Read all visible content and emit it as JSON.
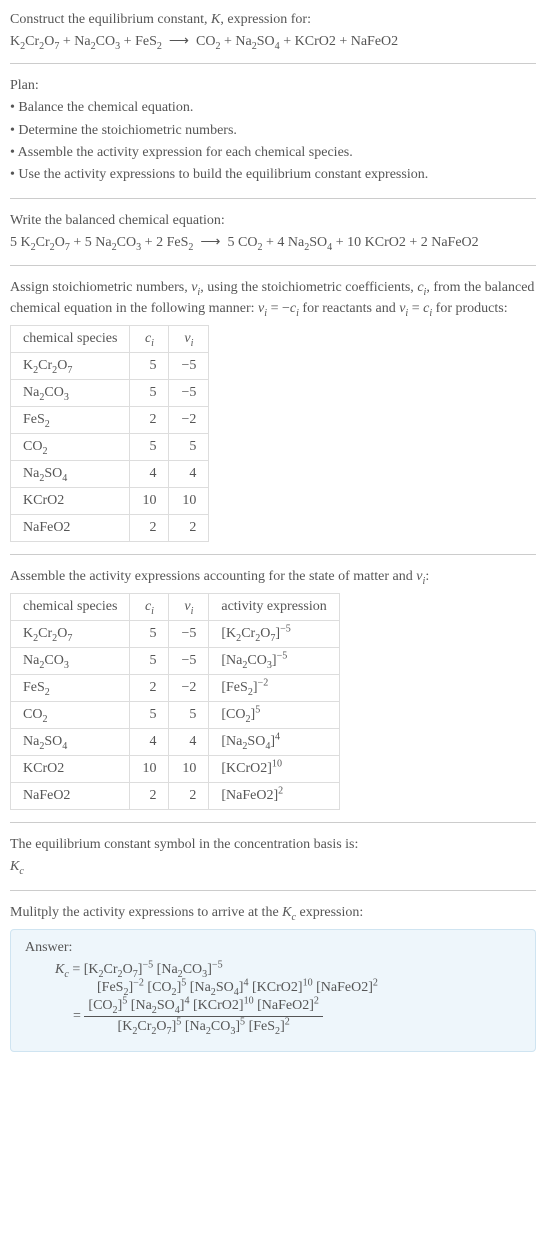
{
  "intro": {
    "line1_html": "Construct the equilibrium constant, <i>K</i>, expression for:",
    "equation_html": "K<sub>2</sub>Cr<sub>2</sub>O<sub>7</sub> + Na<sub>2</sub>CO<sub>3</sub> + FeS<sub>2</sub> &nbsp;⟶&nbsp; CO<sub>2</sub> + Na<sub>2</sub>SO<sub>4</sub> + KCrO2 + NaFeO2"
  },
  "plan": {
    "title": "Plan:",
    "items": [
      "• Balance the chemical equation.",
      "• Determine the stoichiometric numbers.",
      "• Assemble the activity expression for each chemical species.",
      "• Use the activity expressions to build the equilibrium constant expression."
    ]
  },
  "balanced": {
    "title": "Write the balanced chemical equation:",
    "equation_html": "5 K<sub>2</sub>Cr<sub>2</sub>O<sub>7</sub> + 5 Na<sub>2</sub>CO<sub>3</sub> + 2 FeS<sub>2</sub> &nbsp;⟶&nbsp; 5 CO<sub>2</sub> + 4 Na<sub>2</sub>SO<sub>4</sub> + 10 KCrO2 + 2 NaFeO2"
  },
  "assign": {
    "text_html": "Assign stoichiometric numbers, <i>ν<sub>i</sub></i>, using the stoichiometric coefficients, <i>c<sub>i</sub></i>, from the balanced chemical equation in the following manner: <i>ν<sub>i</sub></i> = −<i>c<sub>i</sub></i> for reactants and <i>ν<sub>i</sub></i> = <i>c<sub>i</sub></i> for products:"
  },
  "table1": {
    "headers": {
      "species": "chemical species",
      "ci_html": "<i>c<sub>i</sub></i>",
      "vi_html": "<i>ν<sub>i</sub></i>"
    },
    "rows": [
      {
        "species_html": "K<sub>2</sub>Cr<sub>2</sub>O<sub>7</sub>",
        "ci": "5",
        "vi": "−5"
      },
      {
        "species_html": "Na<sub>2</sub>CO<sub>3</sub>",
        "ci": "5",
        "vi": "−5"
      },
      {
        "species_html": "FeS<sub>2</sub>",
        "ci": "2",
        "vi": "−2"
      },
      {
        "species_html": "CO<sub>2</sub>",
        "ci": "5",
        "vi": "5"
      },
      {
        "species_html": "Na<sub>2</sub>SO<sub>4</sub>",
        "ci": "4",
        "vi": "4"
      },
      {
        "species_html": "KCrO2",
        "ci": "10",
        "vi": "10"
      },
      {
        "species_html": "NaFeO2",
        "ci": "2",
        "vi": "2"
      }
    ]
  },
  "assemble": {
    "text_html": "Assemble the activity expressions accounting for the state of matter and <i>ν<sub>i</sub></i>:"
  },
  "table2": {
    "headers": {
      "species": "chemical species",
      "ci_html": "<i>c<sub>i</sub></i>",
      "vi_html": "<i>ν<sub>i</sub></i>",
      "activity": "activity expression"
    },
    "rows": [
      {
        "species_html": "K<sub>2</sub>Cr<sub>2</sub>O<sub>7</sub>",
        "ci": "5",
        "vi": "−5",
        "activity_html": "[K<sub>2</sub>Cr<sub>2</sub>O<sub>7</sub>]<sup>−5</sup>"
      },
      {
        "species_html": "Na<sub>2</sub>CO<sub>3</sub>",
        "ci": "5",
        "vi": "−5",
        "activity_html": "[Na<sub>2</sub>CO<sub>3</sub>]<sup>−5</sup>"
      },
      {
        "species_html": "FeS<sub>2</sub>",
        "ci": "2",
        "vi": "−2",
        "activity_html": "[FeS<sub>2</sub>]<sup>−2</sup>"
      },
      {
        "species_html": "CO<sub>2</sub>",
        "ci": "5",
        "vi": "5",
        "activity_html": "[CO<sub>2</sub>]<sup>5</sup>"
      },
      {
        "species_html": "Na<sub>2</sub>SO<sub>4</sub>",
        "ci": "4",
        "vi": "4",
        "activity_html": "[Na<sub>2</sub>SO<sub>4</sub>]<sup>4</sup>"
      },
      {
        "species_html": "KCrO2",
        "ci": "10",
        "vi": "10",
        "activity_html": "[KCrO2]<sup>10</sup>"
      },
      {
        "species_html": "NaFeO2",
        "ci": "2",
        "vi": "2",
        "activity_html": "[NaFeO2]<sup>2</sup>"
      }
    ]
  },
  "symbol": {
    "line1": "The equilibrium constant symbol in the concentration basis is:",
    "line2_html": "<i>K<sub>c</sub></i>"
  },
  "multiply": {
    "text_html": "Mulitply the activity expressions to arrive at the <i>K<sub>c</sub></i> expression:"
  },
  "answer": {
    "label": "Answer:",
    "line1_html": "<i>K<sub>c</sub></i> = [K<sub>2</sub>Cr<sub>2</sub>O<sub>7</sub>]<sup>−5</sup> [Na<sub>2</sub>CO<sub>3</sub>]<sup>−5</sup>",
    "line2_html": "[FeS<sub>2</sub>]<sup>−2</sup> [CO<sub>2</sub>]<sup>5</sup> [Na<sub>2</sub>SO<sub>4</sub>]<sup>4</sup> [KCrO2]<sup>10</sup> [NaFeO2]<sup>2</sup>",
    "equals": "=",
    "frac_num_html": "[CO<sub>2</sub>]<sup>5</sup> [Na<sub>2</sub>SO<sub>4</sub>]<sup>4</sup> [KCrO2]<sup>10</sup> [NaFeO2]<sup>2</sup>",
    "frac_den_html": "[K<sub>2</sub>Cr<sub>2</sub>O<sub>7</sub>]<sup>5</sup> [Na<sub>2</sub>CO<sub>3</sub>]<sup>5</sup> [FeS<sub>2</sub>]<sup>2</sup>"
  }
}
